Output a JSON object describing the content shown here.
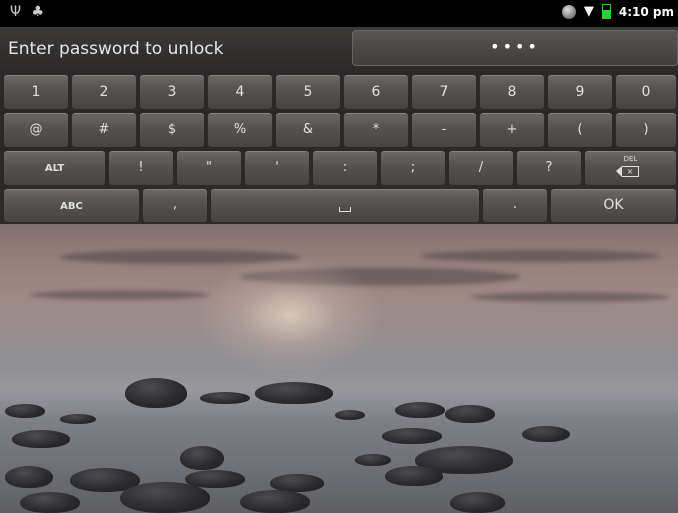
{
  "status_bar": {
    "time": "4:10 pm",
    "icons": [
      "usb-icon",
      "notification-icon",
      "globe-icon",
      "wifi-icon",
      "battery-icon"
    ]
  },
  "unlock": {
    "prompt": "Enter password to unlock",
    "password_mask": "••••"
  },
  "keyboard": {
    "row1": [
      "1",
      "2",
      "3",
      "4",
      "5",
      "6",
      "7",
      "8",
      "9",
      "0"
    ],
    "row2": [
      "@",
      "#",
      "$",
      "%",
      "&",
      "*",
      "-",
      "+",
      "(",
      ")"
    ],
    "row3": [
      "ALT",
      "!",
      "\"",
      "'",
      ":",
      ";",
      "/",
      "?"
    ],
    "del_label": "DEL",
    "row4": {
      "abc": "ABC",
      "comma": ",",
      "period": ".",
      "ok": "OK"
    }
  },
  "colors": {
    "status_bar_bg": "#000000",
    "key_face": "#54524f",
    "key_text": "#e0e0e0"
  }
}
